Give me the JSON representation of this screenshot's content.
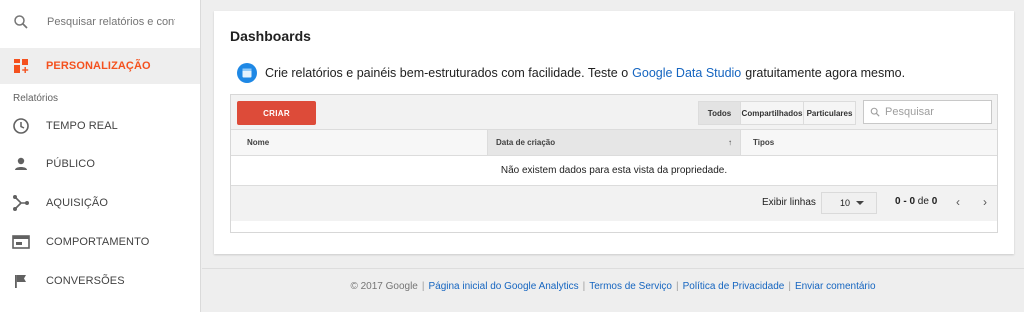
{
  "sidebar": {
    "search_placeholder": "Pesquisar relatórios e conteúdo",
    "personalizacao": "PERSONALIZAÇÃO",
    "section_label": "Relatórios",
    "items": [
      {
        "label": "TEMPO REAL",
        "icon": "clock-icon"
      },
      {
        "label": "PÚBLICO",
        "icon": "person-icon"
      },
      {
        "label": "AQUISIÇÃO",
        "icon": "acquisition-icon"
      },
      {
        "label": "COMPORTAMENTO",
        "icon": "behavior-icon"
      },
      {
        "label": "CONVERSÕES",
        "icon": "flag-icon"
      }
    ]
  },
  "main": {
    "title": "Dashboards",
    "promo": {
      "before": "Crie relatórios e painéis bem-estruturados com facilidade. Teste o",
      "link": "Google Data Studio",
      "after": "gratuitamente agora mesmo."
    },
    "toolbar": {
      "create_label": "CRIAR",
      "filters": [
        "Todos",
        "Compartilhados",
        "Particulares"
      ],
      "search_placeholder": "Pesquisar"
    },
    "table": {
      "columns": [
        "Nome",
        "Data de criação",
        "Tipos"
      ],
      "sort_indicator": "↑",
      "empty_message": "Não existem dados para esta vista da propriedade."
    },
    "pagination": {
      "rows_label": "Exibir linhas",
      "rows_value": "10",
      "range_start": "0",
      "range_sep": " - ",
      "range_end": "0",
      "of_label": " de ",
      "total": "0",
      "prev": "‹",
      "next": "›"
    }
  },
  "footer": {
    "copyright": "© 2017 Google",
    "links": [
      "Página inicial do Google Analytics",
      "Termos de Serviço",
      "Política de Privacidade",
      "Enviar comentário"
    ]
  },
  "colors": {
    "accent": "#f4511e",
    "create_button": "#dd4b39",
    "link": "#1565c0"
  }
}
